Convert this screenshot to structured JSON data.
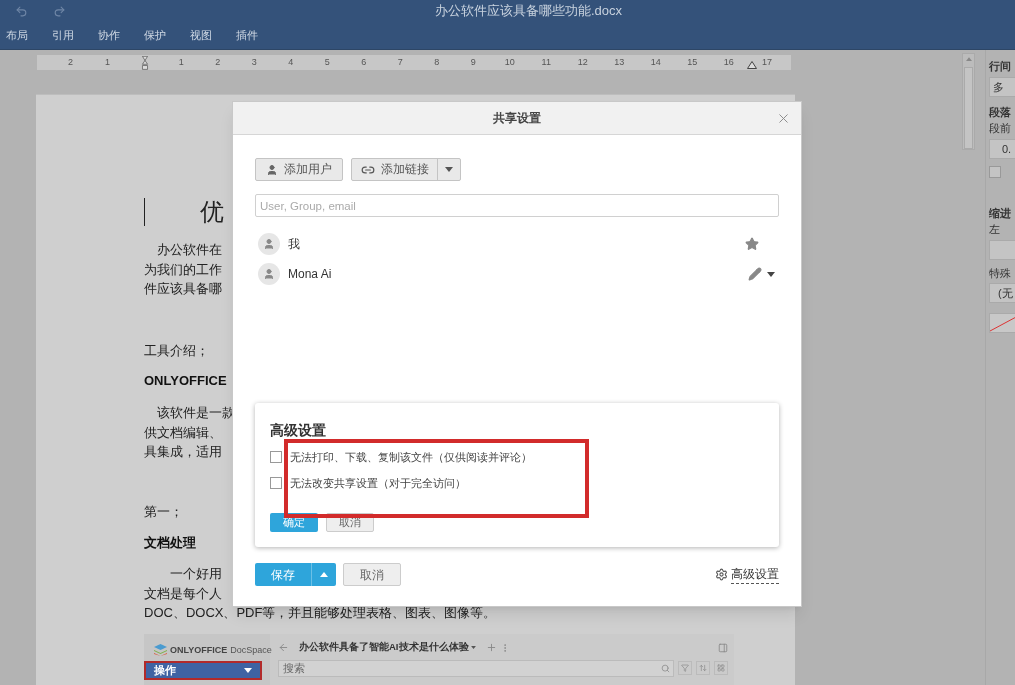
{
  "window": {
    "title": "办公软件应该具备哪些功能.docx"
  },
  "menu": [
    "布局",
    "引用",
    "协作",
    "保护",
    "视图",
    "插件"
  ],
  "ruler": {
    "labels_before": [
      "2",
      "1"
    ],
    "labels_after": [
      "1",
      "2",
      "3",
      "4",
      "5",
      "6",
      "7",
      "8",
      "9",
      "10",
      "11",
      "12",
      "13",
      "14",
      "15",
      "16"
    ],
    "label_end": "17"
  },
  "document": {
    "blocks": [
      {
        "kind": "heading",
        "lines": [
          "优"
        ]
      },
      {
        "kind": "paragraph",
        "lines": [
          "办公软件在",
          "为我们的工作",
          "件应该具备哪"
        ]
      },
      {
        "kind": "paragraph",
        "lines": [
          "工具介绍；"
        ]
      },
      {
        "kind": "bold",
        "lines": [
          "ONLYOFFICE"
        ]
      },
      {
        "kind": "paragraph",
        "lines": [
          "该软件是一款",
          "供文档编辑、",
          "具集成，适用"
        ]
      },
      {
        "kind": "paragraph",
        "lines": [
          "第一；"
        ]
      },
      {
        "kind": "bold",
        "lines": [
          "文档处理"
        ]
      },
      {
        "kind": "paragraph",
        "lines": [
          "一个好用",
          "文档是每个人",
          "DOC、DOCX、PDF等，并且能够处理表格、图表、图像等。"
        ]
      }
    ],
    "embedded_screenshot": {
      "logo_brand": "ONLYOFFICE",
      "logo_product": "DocSpace",
      "action_button": "操作",
      "title": "办公软件具备了智能AI技术是什么体验",
      "search": {
        "placeholder": "搜索"
      }
    }
  },
  "right_panel": {
    "line_spacing_label": "行间",
    "line_spacing_value": "多",
    "paragraph_spacing_label": "段落",
    "before_label": "段前",
    "before_value": "0.",
    "checkbox": {
      "checked": false
    },
    "indent_label": "缩进",
    "left_label": "左",
    "special_label": "特殊",
    "special_value": "(无"
  },
  "dialog": {
    "title": "共享设置",
    "add_user": "添加用户",
    "add_link": "添加链接",
    "search": {
      "placeholder": "User, Group, email"
    },
    "users": [
      {
        "name": "我",
        "kind": "owner"
      },
      {
        "name": "Mona Ai",
        "kind": "editor"
      }
    ],
    "advanced": {
      "title": "高级设置",
      "options": [
        {
          "label": "无法打印、下载、复制该文件（仅供阅读并评论）",
          "checked": false
        },
        {
          "label": "无法改变共享设置（对于完全访问）",
          "checked": false
        }
      ],
      "ok": "确定",
      "cancel": "取消"
    },
    "save": "保存",
    "cancel": "取消",
    "advanced_link": "高级设置"
  }
}
